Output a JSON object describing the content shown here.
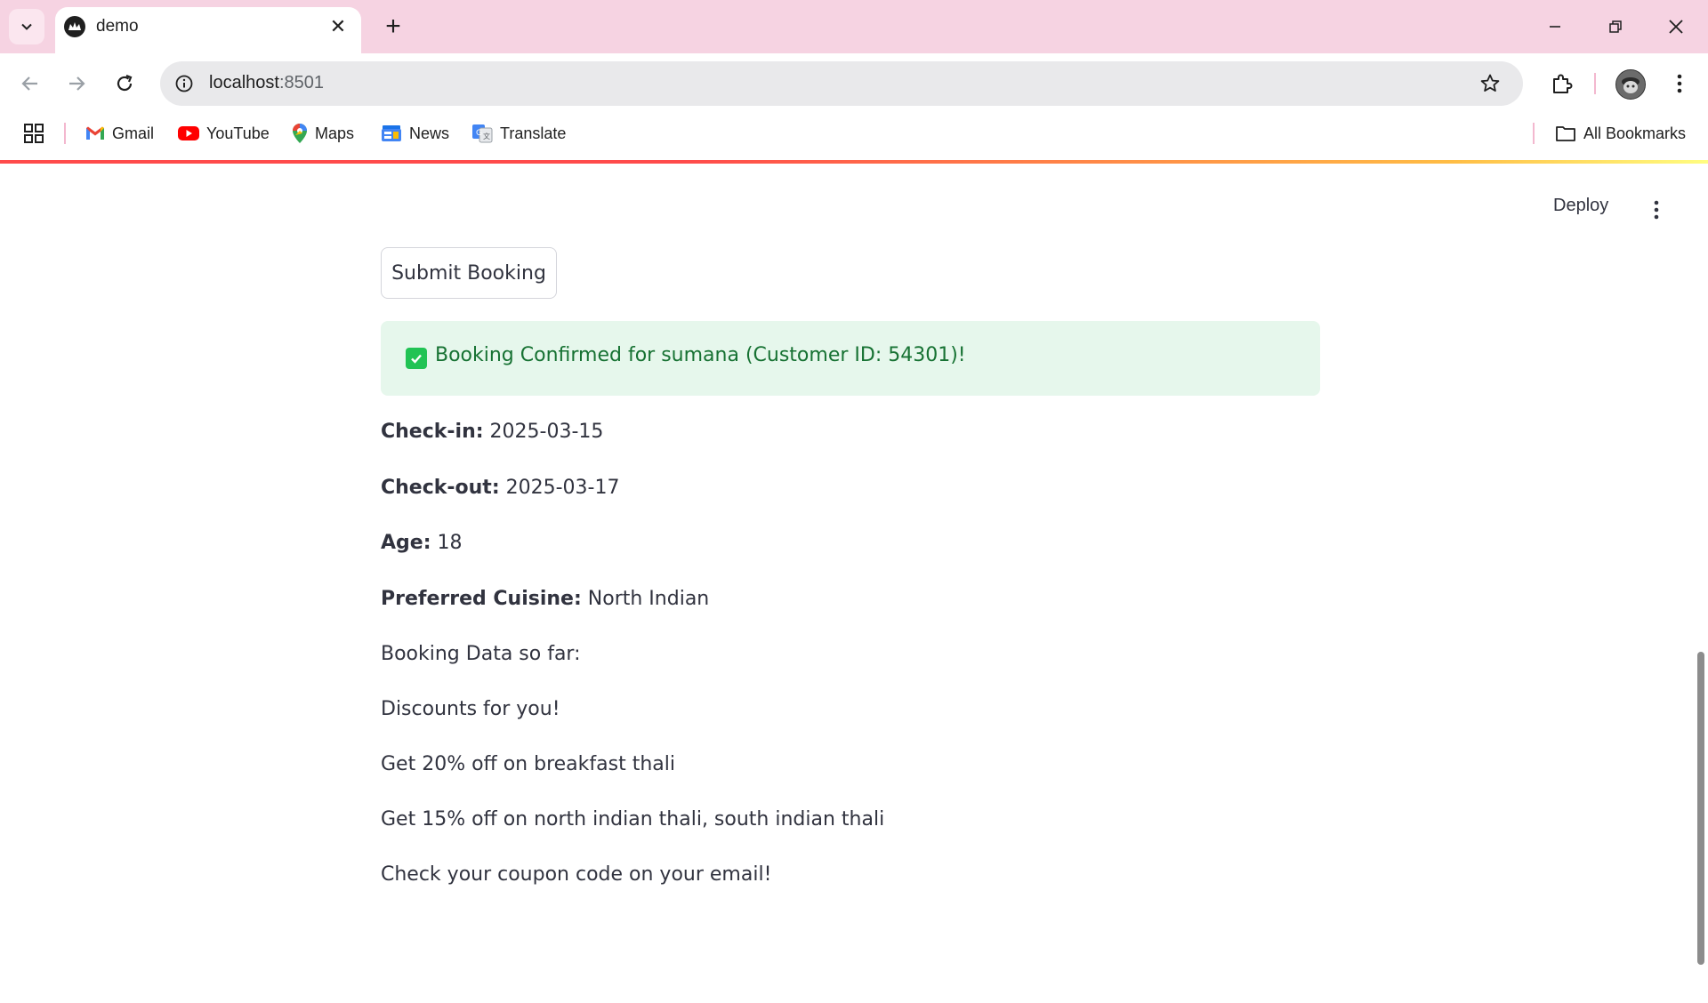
{
  "browser": {
    "tab_title": "demo",
    "url_host": "localhost",
    "url_port": ":8501",
    "bookmarks": [
      {
        "label": "Gmail",
        "icon": "gmail-icon"
      },
      {
        "label": "YouTube",
        "icon": "youtube-icon"
      },
      {
        "label": "Maps",
        "icon": "maps-icon"
      },
      {
        "label": "News",
        "icon": "news-icon"
      },
      {
        "label": "Translate",
        "icon": "translate-icon"
      }
    ],
    "all_bookmarks": "All Bookmarks"
  },
  "app": {
    "deploy_label": "Deploy",
    "submit_label": "Submit Booking",
    "success_message": "Booking Confirmed for sumana (Customer ID: 54301)!",
    "details": [
      {
        "label": "Check-in:",
        "value": "2025-03-15"
      },
      {
        "label": "Check-out:",
        "value": "2025-03-17"
      },
      {
        "label": "Age:",
        "value": "18"
      },
      {
        "label": "Preferred Cuisine:",
        "value": "North Indian"
      }
    ],
    "lines": [
      "Booking Data so far:",
      "Discounts for you!",
      "Get 20% off on breakfast thali",
      "Get 15% off on north indian thali, south indian thali",
      "Check your coupon code on your email!"
    ]
  },
  "colors": {
    "tabstrip": "#f6d3e2",
    "success_bg": "#e6f7ec",
    "success_text": "#177233",
    "success_icon": "#21c354"
  }
}
